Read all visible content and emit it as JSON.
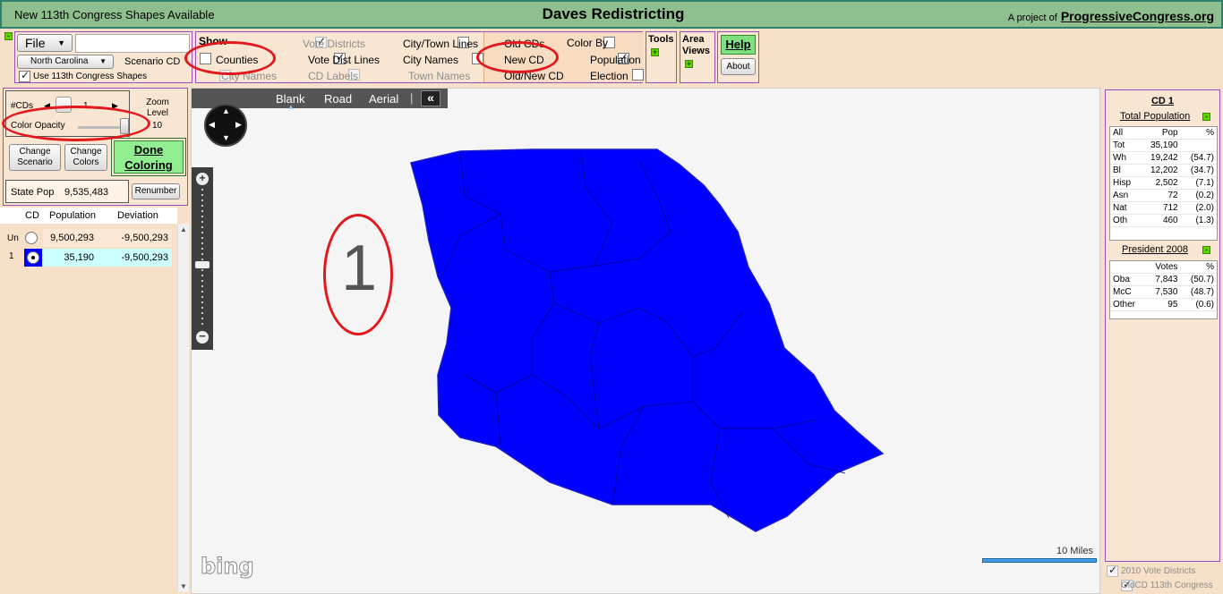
{
  "header": {
    "left_text": "New 113th Congress Shapes Available",
    "title": "Daves Redistricting",
    "project_prefix": "A project of",
    "project_link": "ProgressiveCongress.org"
  },
  "file_panel": {
    "file_label": "File",
    "state_select": "North Carolina",
    "scenario": "Scenario CD",
    "use_shapes_label": "Use 113th Congress Shapes",
    "use_shapes_checked": true
  },
  "show_panel": {
    "title": "Show",
    "counties": "Counties",
    "city_names_dim": "City Names",
    "vote_districts": "Vote Districts",
    "vote_dist_lines": "Vote Dist Lines",
    "cd_labels": "CD Labels",
    "city_town_lines": "City/Town Lines",
    "city_names": "City Names",
    "town_names": "Town Names",
    "old_cds": "Old CDs",
    "new_cd": "New CD",
    "old_new_cd": "Old/New CD",
    "color_by": "Color By",
    "population": "Population",
    "election": "Election"
  },
  "tools": {
    "tools": "Tools",
    "area_views": "Area Views",
    "help": "Help",
    "about": "About"
  },
  "left_controls": {
    "num_cds_label": "#CDs",
    "num_cds_value": "1",
    "zoom_label": "Zoom Level",
    "zoom_value": "10",
    "color_opacity": "Color Opacity",
    "change_scenario": "Change Scenario",
    "change_colors": "Change Colors",
    "done_coloring": "Done Coloring",
    "state_pop_label": "State Pop",
    "state_pop_value": "9,535,483",
    "renumber": "Renumber"
  },
  "cd_table": {
    "headers": [
      "CD",
      "Population",
      "Deviation"
    ],
    "rows": [
      {
        "cd": "Un",
        "population": "9,500,293",
        "deviation": "-9,500,293"
      },
      {
        "cd": "1",
        "population": "35,190",
        "deviation": "-9,500,293"
      }
    ]
  },
  "map": {
    "tabs": [
      "Blank",
      "Road",
      "Aerial"
    ],
    "collapse": "«",
    "annotation": "1",
    "scale": "10 Miles",
    "brand": "bing",
    "district_color": "#0000ff"
  },
  "stats": {
    "title": "CD 1",
    "total_population": "Total Population",
    "pop_headers": [
      "All",
      "Pop",
      "%"
    ],
    "pop_rows": [
      [
        "Tot",
        "35,190",
        ""
      ],
      [
        "Wh",
        "19,242",
        "(54.7)"
      ],
      [
        "Bl",
        "12,202",
        "(34.7)"
      ],
      [
        "Hisp",
        "2,502",
        "(7.1)"
      ],
      [
        "Asn",
        "72",
        "(0.2)"
      ],
      [
        "Nat",
        "712",
        "(2.0)"
      ],
      [
        "Oth",
        "460",
        "(1.3)"
      ]
    ],
    "president": "President 2008",
    "vote_headers": [
      "",
      "Votes",
      "%"
    ],
    "vote_rows": [
      [
        "Oba",
        "7,843",
        "(50.7)"
      ],
      [
        "McC",
        "7,530",
        "(48.7)"
      ],
      [
        "Other",
        "95",
        "(0.6)"
      ]
    ],
    "footer_1": "2010 Vote Districts",
    "footer_2": "OldCD 113th Congress"
  },
  "colors": {
    "annotation_red": "#e3171c",
    "panel_border": "#9b4dbf",
    "header_green": "#8fbf8f"
  }
}
